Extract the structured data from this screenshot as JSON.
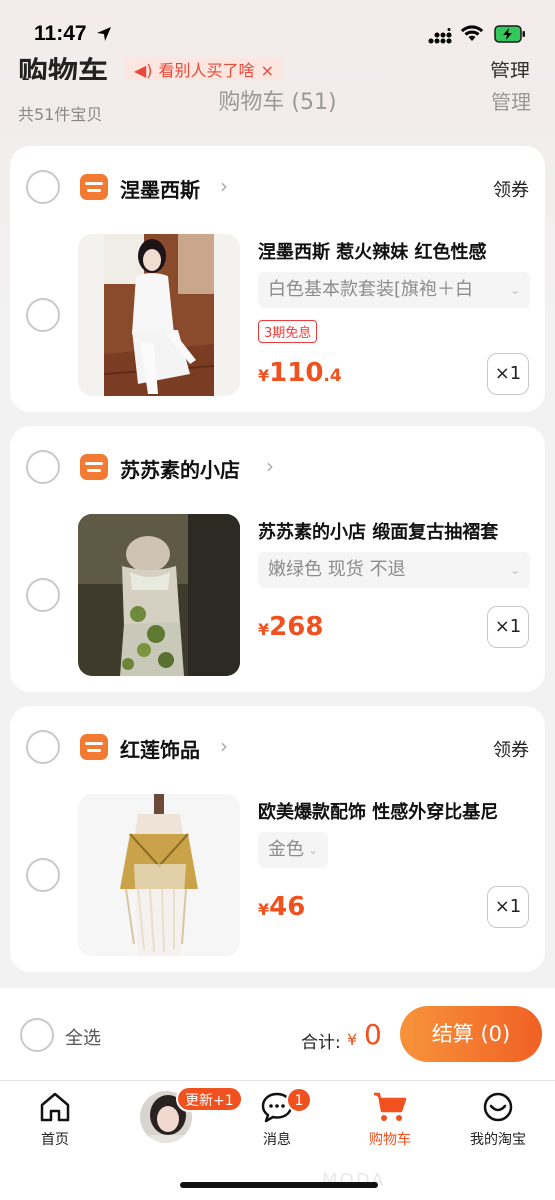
{
  "status_bar": {
    "time": "11:47"
  },
  "header": {
    "big_title": "购物车",
    "banner_text": "看别人买了啥",
    "banner_close": "×",
    "manage_top": "管理",
    "item_count": "共51件宝贝",
    "center_title": "购物车 (51)",
    "manage": "管理"
  },
  "shops": [
    {
      "name": "涅墨西斯",
      "coupon": "领券",
      "item": {
        "title": "涅墨西斯 惹火辣妹 红色性感",
        "sku": "白色基本款套装[旗袍＋白",
        "installment": "3期免息",
        "price_currency": "¥",
        "price_int": "110",
        "price_dec": ".4",
        "qty": "×1"
      }
    },
    {
      "name": "苏苏素的小店",
      "coupon": "",
      "item": {
        "title": "苏苏素的小店 缎面复古抽褶套",
        "sku": "嫩绿色 现货 不退",
        "price_currency": "¥",
        "price_int": "268",
        "price_dec": "",
        "qty": "×1"
      }
    },
    {
      "name": "红莲饰品",
      "coupon": "领券",
      "item": {
        "title": "欧美爆款配饰 性感外穿比基尼",
        "sku": "金色",
        "price_currency": "¥",
        "price_int": "46",
        "price_dec": "",
        "qty": "×1"
      }
    }
  ],
  "checkout": {
    "select_all": "全选",
    "total_label": "合计:",
    "total_currency": "¥",
    "total_value": "0",
    "pay_button": "结算 (0)"
  },
  "tabbar": {
    "home": "首页",
    "update_badge": "更新+1",
    "messages": "消息",
    "messages_badge": "1",
    "cart": "购物车",
    "my_taobao": "我的淘宝"
  },
  "colors": {
    "accent": "#f0511e",
    "shop_icon": "#f27a32"
  }
}
